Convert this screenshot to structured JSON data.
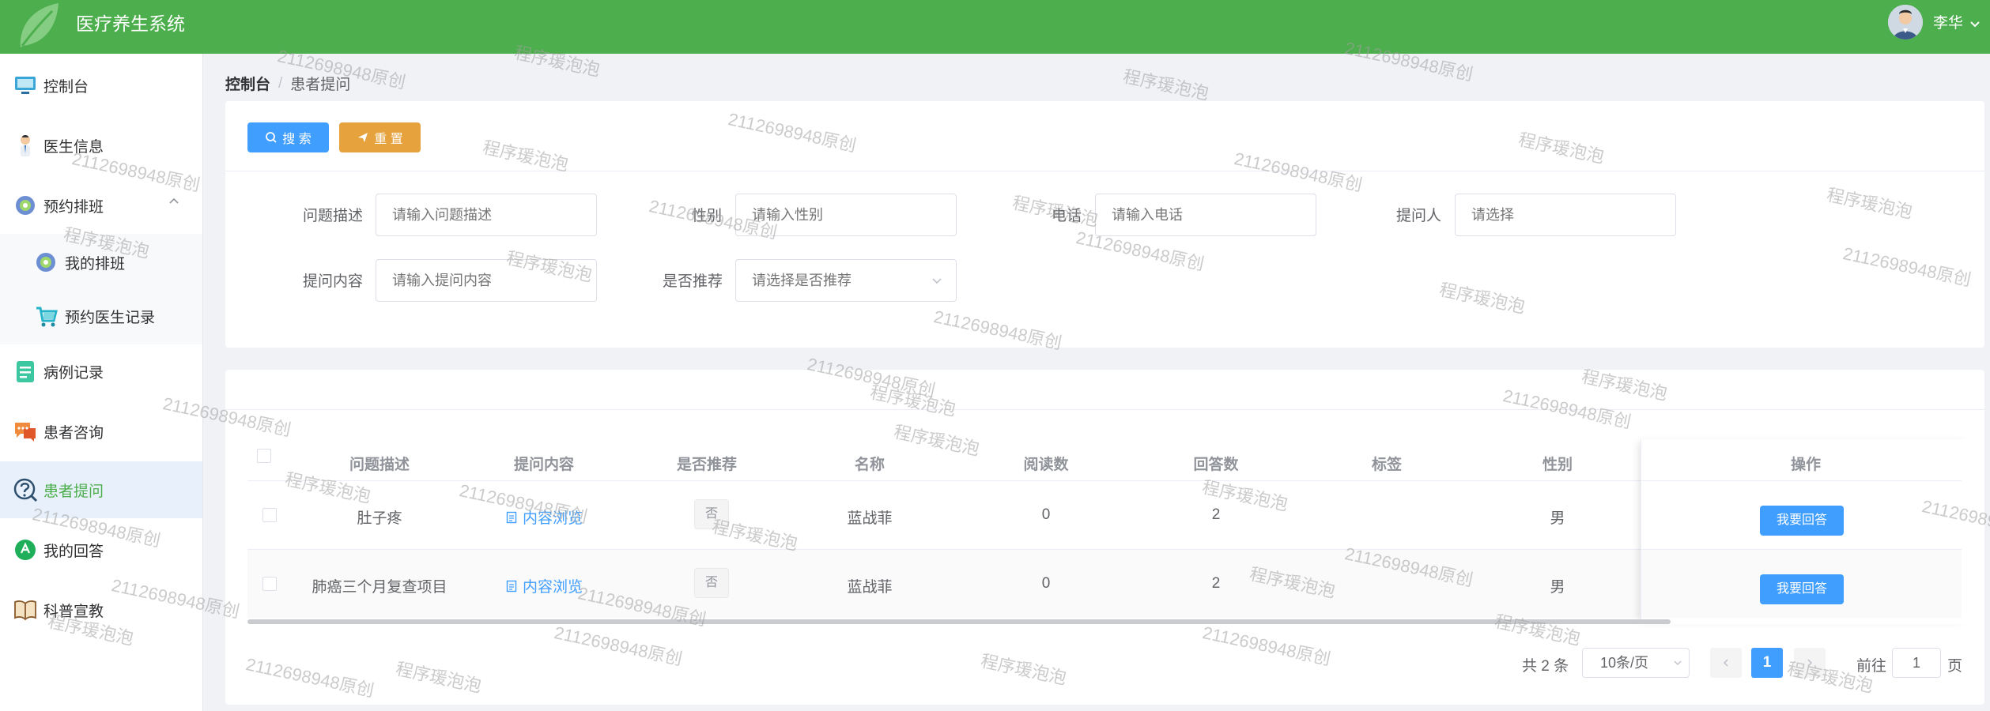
{
  "header": {
    "title": "医疗养生系统",
    "user_name": "李华"
  },
  "sidebar": {
    "items": [
      {
        "label": "控制台",
        "icon": "monitor-icon"
      },
      {
        "label": "医生信息",
        "icon": "doctor-icon"
      },
      {
        "label": "预约排班",
        "icon": "gear-icon",
        "expanded": true
      },
      {
        "label": "我的排班",
        "icon": "gear-icon"
      },
      {
        "label": "预约医生记录",
        "icon": "cart-icon"
      },
      {
        "label": "病例记录",
        "icon": "document-icon"
      },
      {
        "label": "患者咨询",
        "icon": "chat-icon"
      },
      {
        "label": "患者提问",
        "icon": "question-icon",
        "active": true
      },
      {
        "label": "我的回答",
        "icon": "answer-icon"
      },
      {
        "label": "科普宣教",
        "icon": "book-icon"
      }
    ]
  },
  "breadcrumb": {
    "home": "控制台",
    "current": "患者提问",
    "separator": "/"
  },
  "search": {
    "search_button": "搜 索",
    "reset_button": "重 置",
    "fields": {
      "question_desc": {
        "label": "问题描述",
        "placeholder": "请输入问题描述"
      },
      "gender": {
        "label": "性别",
        "placeholder": "请输入性别"
      },
      "phone": {
        "label": "电话",
        "placeholder": "请输入电话"
      },
      "asker": {
        "label": "提问人",
        "placeholder": "请选择"
      },
      "question_content": {
        "label": "提问内容",
        "placeholder": "请输入提问内容"
      },
      "recommended": {
        "label": "是否推荐",
        "placeholder": "请选择是否推荐"
      }
    }
  },
  "table": {
    "columns": [
      "问题描述",
      "提问内容",
      "是否推荐",
      "名称",
      "阅读数",
      "回答数",
      "标签",
      "性别",
      "操作"
    ],
    "rows": [
      {
        "desc": "肚子疼",
        "content_link": "内容浏览",
        "recommended": "否",
        "name": "蓝战菲",
        "reads": "0",
        "answers": "2",
        "tag": "",
        "gender": "男",
        "action": "我要回答"
      },
      {
        "desc": "肺癌三个月复查项目",
        "content_link": "内容浏览",
        "recommended": "否",
        "name": "蓝战菲",
        "reads": "0",
        "answers": "2",
        "tag": "",
        "gender": "男",
        "action": "我要回答"
      }
    ]
  },
  "pagination": {
    "total": "共 2 条",
    "page_size": "10条/页",
    "current_page": "1",
    "goto_label": "前往",
    "goto_value": "1",
    "page_unit": "页"
  },
  "watermark": {
    "id_text": "2112698948原创",
    "name_text": "程序瑗泡泡"
  },
  "colors": {
    "header_green": "#4cae4c",
    "primary_blue": "#409eff",
    "warning_orange": "#e6a23c"
  }
}
